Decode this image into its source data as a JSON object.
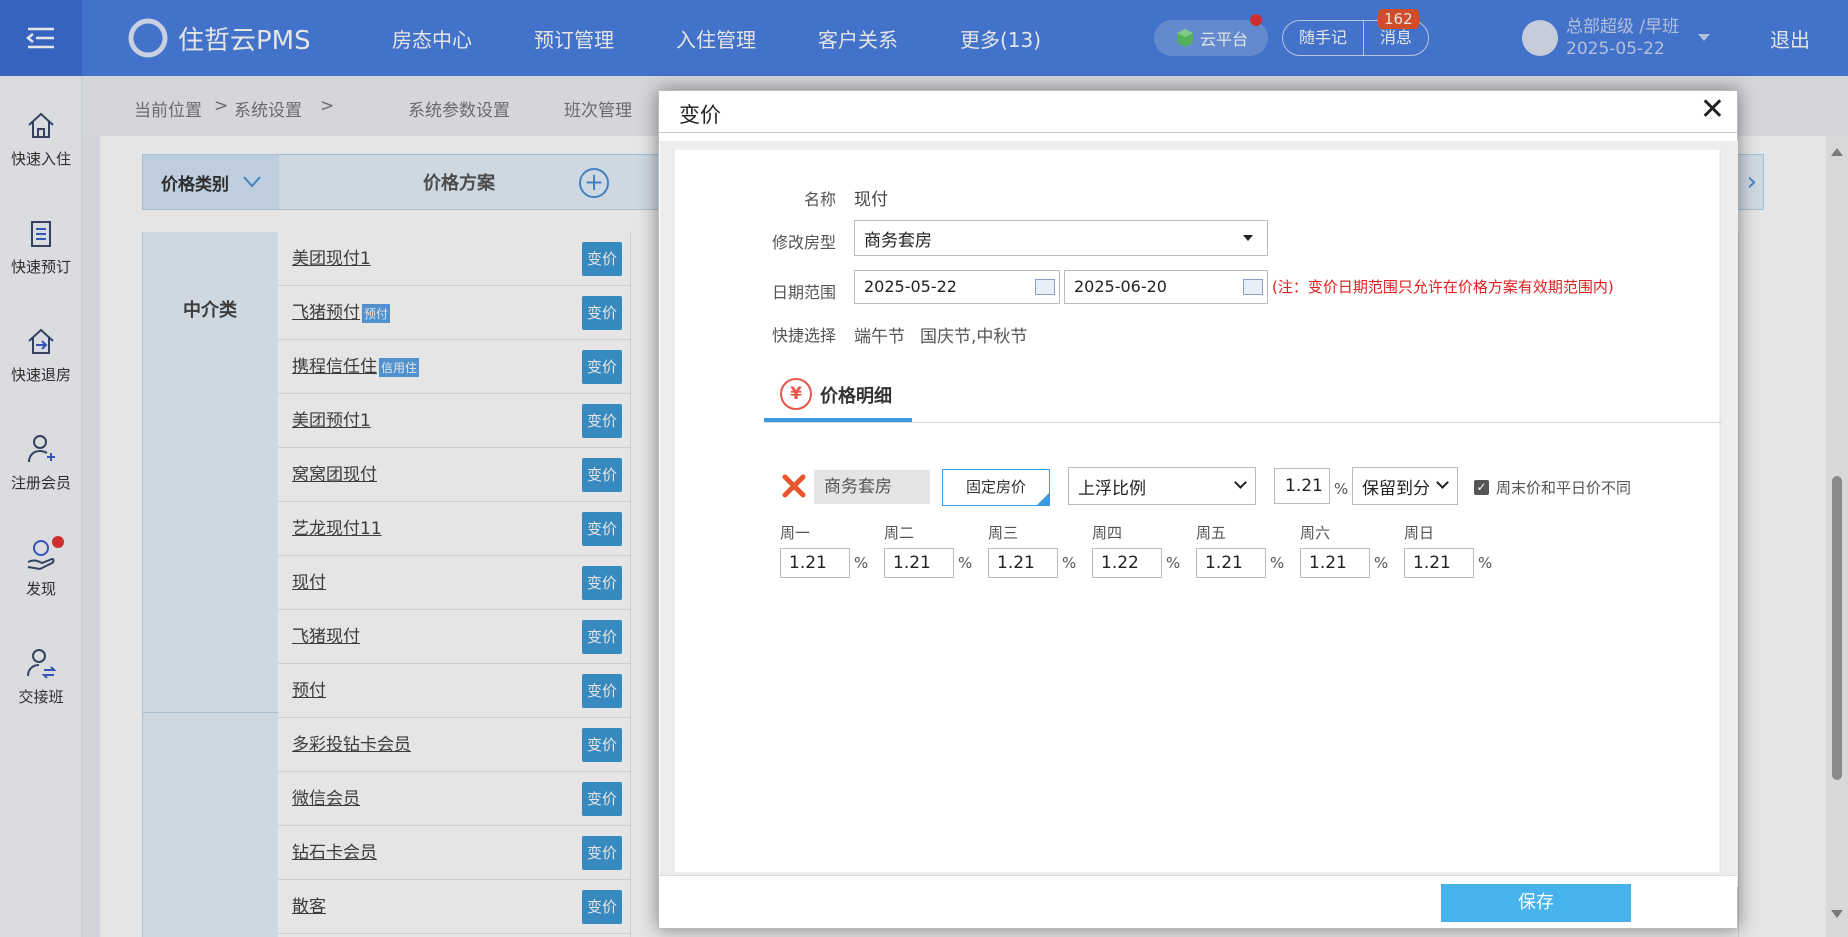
{
  "app": {
    "logo_text": "住哲云PMS",
    "nav": [
      "房态中心",
      "预订管理",
      "入住管理",
      "客户关系",
      "更多(13)"
    ],
    "cloud_label": "云平台",
    "memo_label": "随手记",
    "message_label": "消息",
    "message_count": "162",
    "user_name": "总部超级 /早班",
    "user_date": "2025-05-22",
    "logout_label": "退出"
  },
  "sidebar": {
    "items": [
      {
        "label": "快速入住",
        "icon": "home-icon"
      },
      {
        "label": "快速预订",
        "icon": "document-icon"
      },
      {
        "label": "快速退房",
        "icon": "checkout-icon"
      },
      {
        "label": "注册会员",
        "icon": "user-add-icon"
      },
      {
        "label": "发现",
        "icon": "discover-icon"
      },
      {
        "label": "交接班",
        "icon": "shift-icon"
      }
    ]
  },
  "breadcrumb": {
    "current": "当前位置",
    "sep1": ">",
    "section": "系统设置",
    "sep2": ">",
    "tab1": "系统参数设置",
    "tab2": "班次管理"
  },
  "table": {
    "col_category": "价格类别",
    "col_plan": "价格方案",
    "category_1": "中介类",
    "rows": [
      {
        "name": "美团现付1",
        "tag": ""
      },
      {
        "name": "飞猪预付",
        "tag": "预付"
      },
      {
        "name": "携程信任住",
        "tag": "信用住"
      },
      {
        "name": "美团预付1",
        "tag": ""
      },
      {
        "name": "窝窝团现付",
        "tag": ""
      },
      {
        "name": "艺龙现付11",
        "tag": ""
      },
      {
        "name": "现付",
        "tag": ""
      },
      {
        "name": "飞猪现付",
        "tag": ""
      },
      {
        "name": "预付",
        "tag": ""
      },
      {
        "name": "多彩投钻卡会员",
        "tag": ""
      },
      {
        "name": "微信会员",
        "tag": ""
      },
      {
        "name": "钻石卡会员",
        "tag": ""
      },
      {
        "name": "散客",
        "tag": ""
      }
    ],
    "row_button": "变价"
  },
  "dialog": {
    "title": "变价",
    "name_label": "名称",
    "name_value": "现付",
    "room_type_label": "修改房型",
    "room_type_value": "商务套房",
    "date_range_label": "日期范围",
    "date_start": "2025-05-22",
    "date_end": "2025-06-20",
    "date_note": "(注：变价日期范围只允许在价格方案有效期范围内)",
    "quick_label": "快捷选择",
    "quick_options": [
      "端午节",
      "国庆节,中秋节"
    ],
    "tab_label": "价格明细",
    "tab_icon": "¥",
    "detail": {
      "room": "商务套房",
      "fixed_price_label": "固定房价",
      "adjust_mode": "上浮比例",
      "percent": "1.21",
      "percent_sign": "%",
      "rounding": "保留到分",
      "weekend_diff_label": "周末价和平日价不同",
      "weekend_diff_checked": true,
      "days": [
        {
          "label": "周一",
          "value": "1.21"
        },
        {
          "label": "周二",
          "value": "1.21"
        },
        {
          "label": "周三",
          "value": "1.21"
        },
        {
          "label": "周四",
          "value": "1.22"
        },
        {
          "label": "周五",
          "value": "1.21"
        },
        {
          "label": "周六",
          "value": "1.21"
        },
        {
          "label": "周日",
          "value": "1.21"
        }
      ]
    },
    "save_label": "保存"
  },
  "colors": {
    "topbar": "#4a7fe0",
    "accent": "#3b9be0",
    "save_button": "#47b3ec",
    "note_red": "#e02020"
  }
}
